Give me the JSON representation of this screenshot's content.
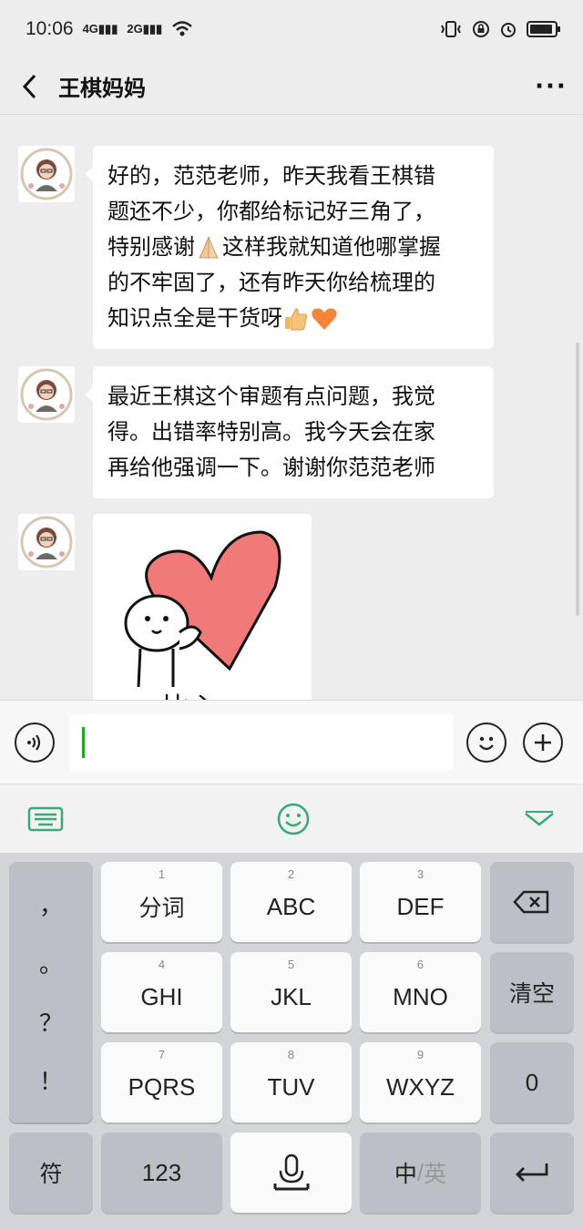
{
  "status": {
    "time": "10:06",
    "sig1": "4G",
    "sig2": "2G"
  },
  "header": {
    "title": "王棋妈妈"
  },
  "messages": [
    {
      "text_lines": [
        "好的，范范老师，昨天我看王棋错",
        "题还不少，你都给标记好三角了，",
        "特别感谢",
        "这样我就知道他哪掌握",
        "的不牢固了，还有昨天你给梳理的",
        "知识点全是干货呀"
      ]
    },
    {
      "text_lines": [
        "最近王棋这个审题有点问题，我觉",
        "得。出错率特别高。我今天会在家",
        "再给他强调一下。谢谢你范范老师"
      ]
    },
    {
      "sticker_text": "比心"
    }
  ],
  "keyboard": {
    "punct": [
      "，",
      "。",
      "？",
      "！"
    ],
    "row1": [
      {
        "num": "1",
        "label": "分词"
      },
      {
        "num": "2",
        "label": "ABC"
      },
      {
        "num": "3",
        "label": "DEF"
      }
    ],
    "row2": [
      {
        "num": "4",
        "label": "GHI"
      },
      {
        "num": "5",
        "label": "JKL"
      },
      {
        "num": "6",
        "label": "MNO"
      }
    ],
    "row3": [
      {
        "num": "7",
        "label": "PQRS"
      },
      {
        "num": "8",
        "label": "TUV"
      },
      {
        "num": "9",
        "label": "WXYZ"
      }
    ],
    "clear": "清空",
    "zero": "0",
    "symbol": "符",
    "numeric": "123",
    "lang_cn": "中",
    "lang_sep": "/",
    "lang_en": "英"
  },
  "colors": {
    "accent": "#1aad19",
    "heart": "#f07a78"
  }
}
